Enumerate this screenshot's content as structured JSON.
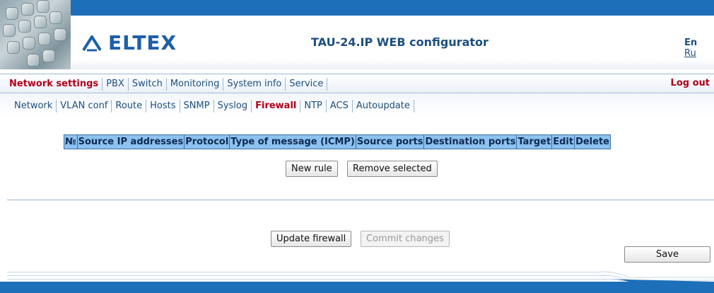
{
  "header": {
    "brand": "ELTEX",
    "title": "TAU-24.IP WEB configurator",
    "lang_current": "En",
    "lang_other": "Ru"
  },
  "main_nav": {
    "items": [
      "Network settings",
      "PBX",
      "Switch",
      "Monitoring",
      "System info",
      "Service"
    ],
    "active": "Network settings",
    "logout": "Log out"
  },
  "sub_nav": {
    "items": [
      "Network",
      "VLAN conf",
      "Route",
      "Hosts",
      "SNMP",
      "Syslog",
      "Firewall",
      "NTP",
      "ACS",
      "Autoupdate"
    ],
    "active": "Firewall"
  },
  "rules_table": {
    "columns": [
      "№",
      "Source IP addresses",
      "Protocol",
      "Type of message (ICMP)",
      "Source ports",
      "Destination ports",
      "Target",
      "Edit",
      "Delete"
    ]
  },
  "buttons": {
    "new_rule": "New rule",
    "remove_selected": "Remove selected",
    "update_firewall": "Update firewall",
    "commit_changes": "Commit changes",
    "save": "Save"
  },
  "colors": {
    "accent_blue": "#1c6fb8",
    "active_red": "#b1001a",
    "table_header": "#8dc1f0"
  }
}
